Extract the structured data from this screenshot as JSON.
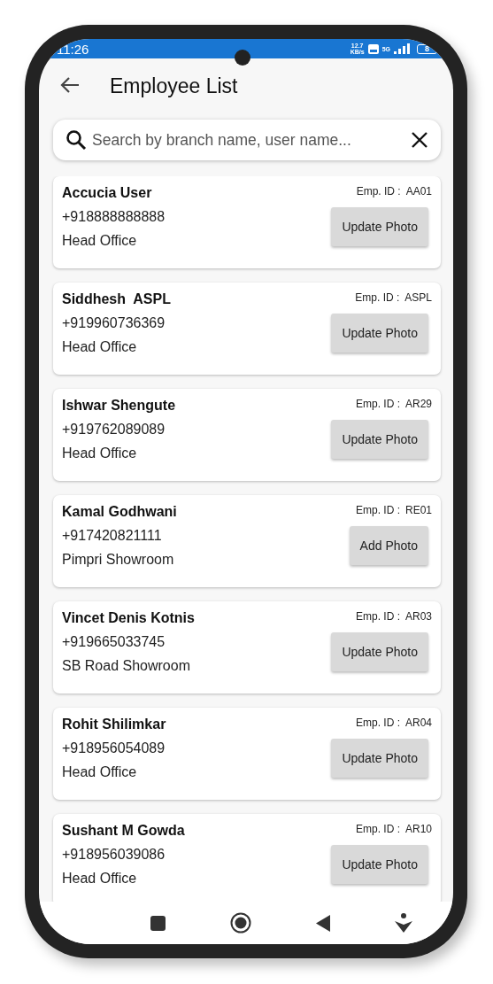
{
  "status_bar": {
    "time": "11:26",
    "speed": "12.7",
    "speed_unit": "KB/s",
    "network": "5G",
    "battery": "8"
  },
  "header": {
    "title": "Employee List"
  },
  "search": {
    "placeholder": "Search by branch name, user name..."
  },
  "employees": [
    {
      "name": "Accucia User",
      "phone": "+918888888888",
      "branch": "Head Office",
      "emp_id_label": "Emp. ID :",
      "emp_id": "AA01",
      "action": "Update Photo"
    },
    {
      "name": "Siddhesh  ASPL",
      "phone": "+919960736369",
      "branch": "Head Office",
      "emp_id_label": "Emp. ID :",
      "emp_id": "ASPL",
      "action": "Update Photo"
    },
    {
      "name": "Ishwar Shengute",
      "phone": "+919762089089",
      "branch": "Head Office",
      "emp_id_label": "Emp. ID :",
      "emp_id": "AR29",
      "action": "Update Photo"
    },
    {
      "name": "Kamal Godhwani",
      "phone": "+917420821111",
      "branch": "Pimpri Showroom",
      "emp_id_label": "Emp. ID :",
      "emp_id": "RE01",
      "action": "Add Photo"
    },
    {
      "name": "Vincet Denis Kotnis",
      "phone": "+919665033745",
      "branch": "SB Road Showroom",
      "emp_id_label": "Emp. ID :",
      "emp_id": "AR03",
      "action": "Update Photo"
    },
    {
      "name": "Rohit Shilimkar",
      "phone": "+918956054089",
      "branch": "Head Office",
      "emp_id_label": "Emp. ID :",
      "emp_id": "AR04",
      "action": "Update Photo"
    },
    {
      "name": "Sushant M Gowda",
      "phone": "+918956039086",
      "branch": "Head Office",
      "emp_id_label": "Emp. ID :",
      "emp_id": "AR10",
      "action": "Update Photo"
    }
  ]
}
